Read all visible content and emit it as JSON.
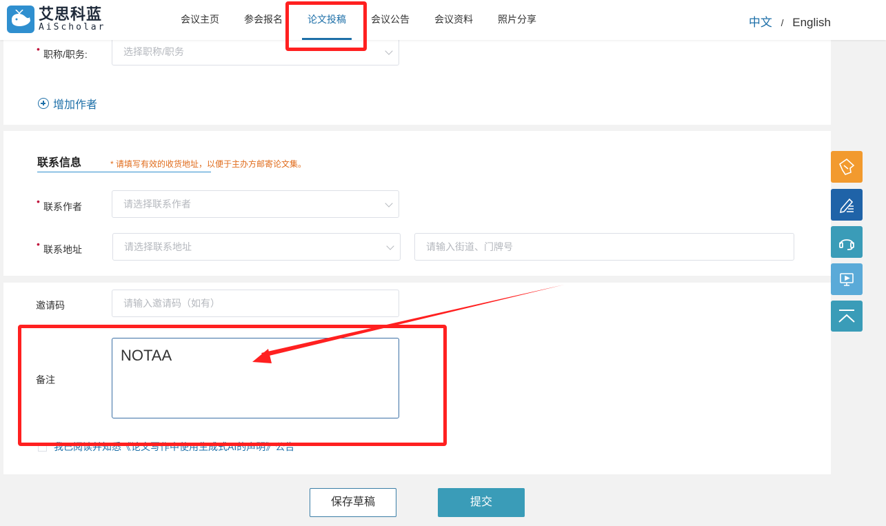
{
  "header": {
    "logo_cn": "艾思科蓝",
    "logo_en": "AiScholar",
    "nav": [
      {
        "label": "会议主页"
      },
      {
        "label": "参会报名"
      },
      {
        "label": "论文投稿"
      },
      {
        "label": "会议公告"
      },
      {
        "label": "会议资料"
      },
      {
        "label": "照片分享"
      }
    ],
    "active_nav": "论文投稿",
    "lang_zh": "中文",
    "lang_sep": "/",
    "lang_en": "English"
  },
  "author_section": {
    "title_label": "职称/职务:",
    "title_placeholder": "选择职称/职务",
    "add_author": "增加作者"
  },
  "contact_section": {
    "title": "联系信息",
    "note": "* 请填写有效的收货地址，以便于主办方邮寄论文集。",
    "contact_author_label": "联系作者",
    "contact_author_placeholder": "请选择联系作者",
    "contact_address_label": "联系地址",
    "contact_address_placeholder": "请选择联系地址",
    "street_placeholder": "请输入街道、门牌号"
  },
  "other_section": {
    "invite_label": "邀请码",
    "invite_placeholder": "请输入邀请码（如有）",
    "remark_label": "备注",
    "remark_value": "NOTAA",
    "agree_text": "我已阅读并知悉《论文写作中使用生成式AI的声明》公告"
  },
  "buttons": {
    "save_draft": "保存草稿",
    "submit": "提交"
  },
  "sidebar_icons": [
    "ticket-icon",
    "pen-icon",
    "headset-icon",
    "presentation-icon",
    "back-to-top-icon"
  ],
  "colors": {
    "brand_blue": "#1d6fa8",
    "submit_teal": "#3a9cb8",
    "annotation_red": "#ff2020",
    "note_orange": "#e06c1c"
  }
}
